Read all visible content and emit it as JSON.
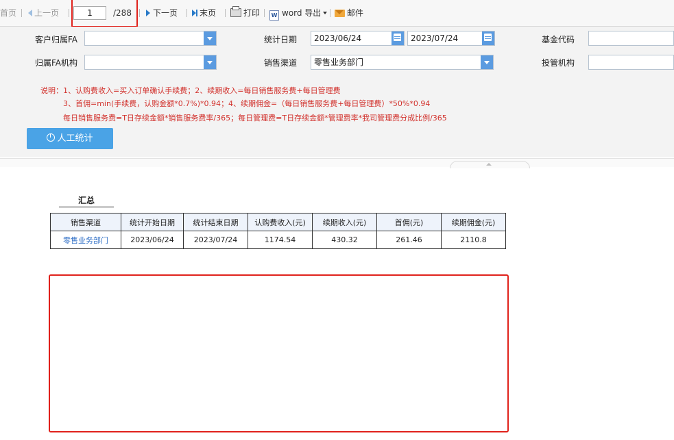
{
  "toolbar": {
    "first_page": "首页",
    "prev_page": "上一页",
    "current_page": "1",
    "total_pages": "/288",
    "next_page": "下一页",
    "last_page": "末页",
    "print": "打印",
    "word_export": "word 导出",
    "mail": "邮件"
  },
  "filters": {
    "customer_fa_label": "客户归属FA",
    "customer_fa_value": "",
    "fa_org_label": "归属FA机构",
    "fa_org_value": "",
    "stat_date_label": "统计日期",
    "start_date": "2023/06/24",
    "end_date": "2023/07/24",
    "sales_channel_label": "销售渠道",
    "sales_channel_value": "零售业务部门",
    "fund_code_label": "基金代码",
    "fund_code_value": "",
    "investment_org_label": "投管机构",
    "investment_org_value": ""
  },
  "notes": {
    "line1": "说明：1、认购费收入=买入订单确认手续费；2、续期收入=每日销售服务费+每日管理费",
    "line2": "3、首佣=min(手续费，认购金额*0.7%)*0.94；4、续期佣金=（每日销售服务费+每日管理费）*50%*0.94",
    "line3": "每日销售服务费=T日存续金额*销售服务费率/365；每日管理费=T日存续金额*管理费率*我司管理费分成比例/365"
  },
  "actions": {
    "manual_stat": "人工统计"
  },
  "report": {
    "title": "汇总",
    "headers": [
      "销售渠道",
      "统计开始日期",
      "统计结束日期",
      "认购费收入(元)",
      "续期收入(元)",
      "首佣(元)",
      "续期佣金(元)"
    ],
    "rows": [
      [
        "零售业务部门",
        "2023/06/24",
        "2023/07/24",
        "1174.54",
        "430.32",
        "261.46",
        "2110.8"
      ]
    ]
  },
  "colors": {
    "accent": "#4aa3e6",
    "note_red": "#d2322d",
    "highlight_red": "#e0211b",
    "link_blue": "#2f6fc6"
  }
}
